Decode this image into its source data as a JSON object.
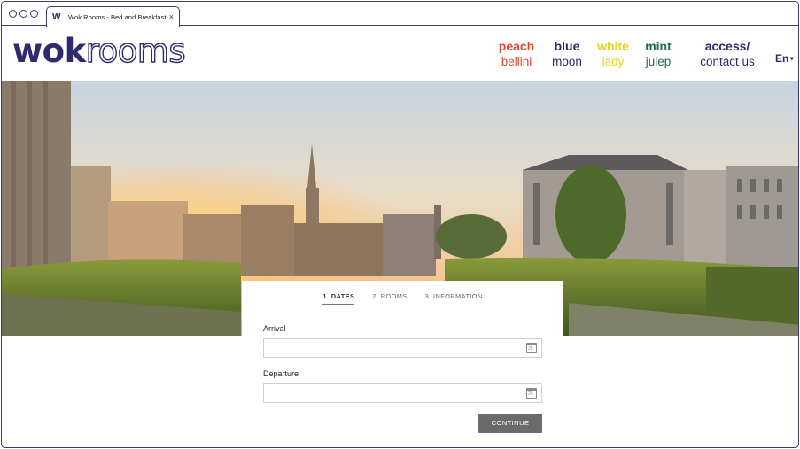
{
  "browser": {
    "tab_favicon": "W",
    "tab_title": "Wok Rooms - Bed and Breakfast",
    "tab_close": "×"
  },
  "site": {
    "logo_bold": "wok",
    "logo_outline": "rooms",
    "nav": [
      {
        "top": "peach",
        "bottom": "bellini",
        "color": "#e0492e"
      },
      {
        "top": "blue",
        "bottom": "moon",
        "color": "#2d2a6e"
      },
      {
        "top": "white",
        "bottom": "lady",
        "color": "#e9d11a"
      },
      {
        "top": "mint",
        "bottom": "julep",
        "color": "#1e6b55"
      },
      {
        "top": "access/",
        "bottom": "contact us",
        "color": "#2d2a6e"
      }
    ],
    "language": "En"
  },
  "booking": {
    "steps": [
      {
        "label": "1. DATES",
        "active": true
      },
      {
        "label": "2. ROOMS",
        "active": false
      },
      {
        "label": "3. INFORMATION",
        "active": false
      }
    ],
    "arrival_label": "Arrival",
    "arrival_value": "",
    "departure_label": "Departure",
    "departure_value": "",
    "calendar_day": "25",
    "continue_label": "CONTINUE"
  },
  "colors": {
    "brand": "#2d2a6e",
    "button": "#6b6b6b"
  },
  "icons": {
    "calendar": "calendar-icon",
    "close": "close-icon",
    "caret": "chevron-down-icon"
  }
}
